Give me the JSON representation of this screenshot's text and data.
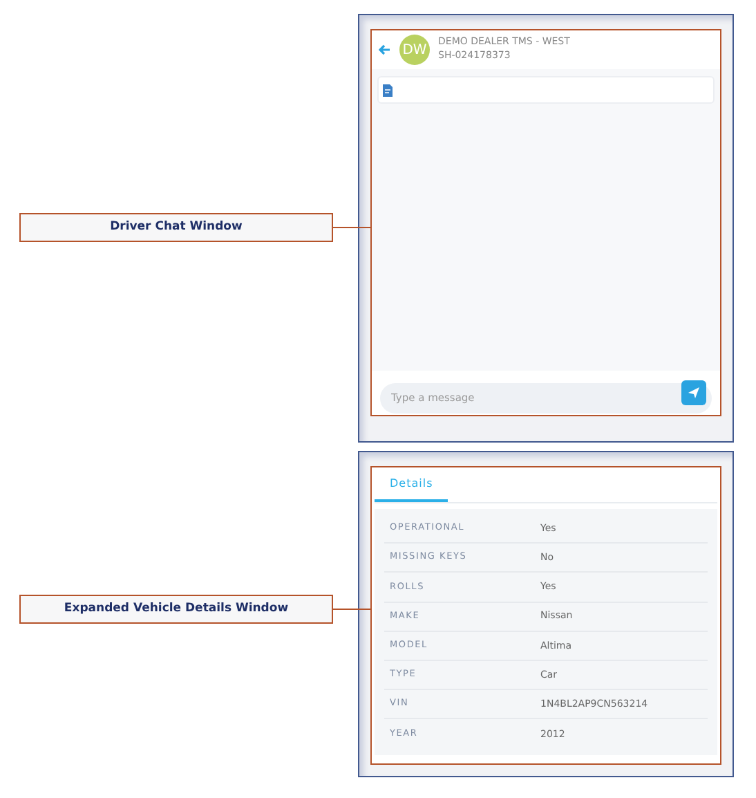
{
  "callouts": [
    {
      "label": "Driver Chat Window"
    },
    {
      "label": "Expanded Vehicle Details Window"
    }
  ],
  "chat": {
    "avatar_initials": "DW",
    "dealer": "DEMO DEALER TMS - WEST",
    "shipment": "SH-024178373",
    "message": {
      "placeholder": "Type a message"
    }
  },
  "details": {
    "tabs": [
      {
        "label": "Details",
        "selected": true
      }
    ],
    "rows": [
      {
        "label": "OPERATIONAL",
        "value": "Yes"
      },
      {
        "label": "MISSING KEYS",
        "value": "No"
      },
      {
        "label": "ROLLS",
        "value": "Yes"
      },
      {
        "label": "MAKE",
        "value": "Nissan"
      },
      {
        "label": "MODEL",
        "value": "Altima"
      },
      {
        "label": "TYPE",
        "value": "Car"
      },
      {
        "label": "VIN",
        "value": "1N4BL2AP9CN563214"
      },
      {
        "label": "YEAR",
        "value": "2012"
      }
    ]
  }
}
